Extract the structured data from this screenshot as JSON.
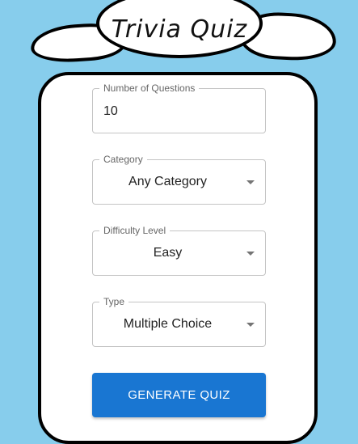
{
  "header": {
    "title": "Trivia Quiz"
  },
  "form": {
    "num_questions": {
      "label": "Number of Questions",
      "value": "10"
    },
    "category": {
      "label": "Category",
      "value": "Any Category"
    },
    "difficulty": {
      "label": "Difficulty Level",
      "value": "Easy"
    },
    "type": {
      "label": "Type",
      "value": "Multiple Choice"
    },
    "generate_label": "GENERATE QUIZ"
  },
  "colors": {
    "background": "#87cdec",
    "primary_button": "#1976d2"
  },
  "icons": [
    "chevron-down-icon"
  ]
}
